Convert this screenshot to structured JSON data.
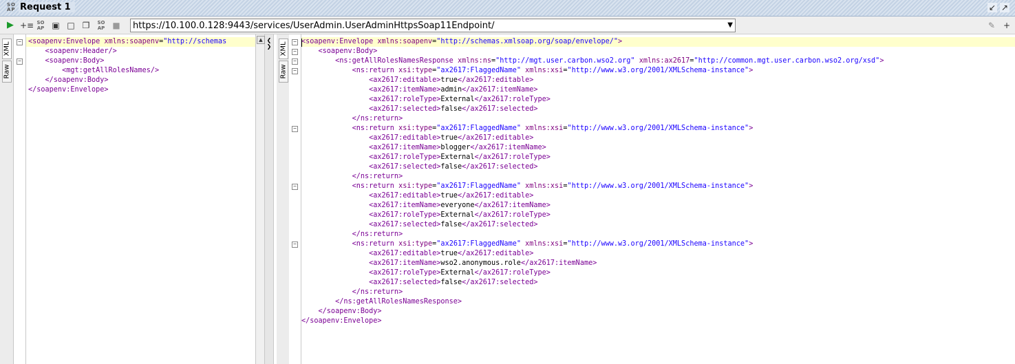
{
  "title_bar": {
    "soap_logo": "SO AP",
    "title": "Request 1",
    "restore_icon": "restore-icon",
    "maximize_icon": "maximize-icon"
  },
  "toolbar": {
    "url": "https://10.100.0.128:9443/services/UserAdmin.UserAdminHttpsSoap11Endpoint/",
    "icons": [
      "run-icon",
      "add-assertion-icon",
      "soap-logo-icon",
      "soap-logo-icon",
      "fit-icon",
      "window-icon",
      "copy-icon",
      "soap-logo-icon",
      "stop-icon",
      "dropdown-icon",
      "settings-icon",
      "add-icon"
    ]
  },
  "request_panel": {
    "tabs": [
      "XML",
      "Raw"
    ],
    "lines": [
      [
        {
          "t": "<soapenv:Envelope ",
          "c": "tag"
        },
        {
          "t": "xmlns:soapenv",
          "c": "attr"
        },
        {
          "t": "=",
          "c": "txt"
        },
        {
          "t": "\"http://schemas",
          "c": "val"
        }
      ],
      [
        {
          "t": "    <soapenv:Header/>",
          "c": "tag"
        }
      ],
      [
        {
          "t": "    <soapenv:Body>",
          "c": "tag"
        }
      ],
      [
        {
          "t": "        <mgt:getAllRolesNames/>",
          "c": "tag"
        }
      ],
      [
        {
          "t": "    </soapenv:Body>",
          "c": "tag"
        }
      ],
      [
        {
          "t": "</soapenv:Envelope>",
          "c": "tag"
        }
      ]
    ]
  },
  "response_panel": {
    "tabs": [
      "XML",
      "Raw"
    ],
    "lines": [
      [
        {
          "t": "<soapenv:Envelope ",
          "c": "tag"
        },
        {
          "t": "xmlns:soapenv",
          "c": "attr"
        },
        {
          "t": "=",
          "c": "txt"
        },
        {
          "t": "\"http://schemas.xmlsoap.org/soap/envelope/\"",
          "c": "val"
        },
        {
          "t": ">",
          "c": "tag"
        }
      ],
      [
        {
          "t": "    <soapenv:Body>",
          "c": "tag"
        }
      ],
      [
        {
          "t": "        <ns:getAllRolesNamesResponse ",
          "c": "tag"
        },
        {
          "t": "xmlns:ns",
          "c": "attr"
        },
        {
          "t": "=",
          "c": "txt"
        },
        {
          "t": "\"http://mgt.user.carbon.wso2.org\"",
          "c": "val"
        },
        {
          "t": " xmlns:ax2617",
          "c": "attr"
        },
        {
          "t": "=",
          "c": "txt"
        },
        {
          "t": "\"http://common.mgt.user.carbon.wso2.org/xsd\"",
          "c": "val"
        },
        {
          "t": ">",
          "c": "tag"
        }
      ],
      [
        {
          "t": "            <ns:return ",
          "c": "tag"
        },
        {
          "t": "xsi:type",
          "c": "attr"
        },
        {
          "t": "=",
          "c": "txt"
        },
        {
          "t": "\"ax2617:FlaggedName\"",
          "c": "val"
        },
        {
          "t": " xmlns:xsi",
          "c": "attr"
        },
        {
          "t": "=",
          "c": "txt"
        },
        {
          "t": "\"http://www.w3.org/2001/XMLSchema-instance\"",
          "c": "val"
        },
        {
          "t": ">",
          "c": "tag"
        }
      ],
      [
        {
          "t": "                <ax2617:editable>",
          "c": "tag"
        },
        {
          "t": "true",
          "c": "txt"
        },
        {
          "t": "</ax2617:editable>",
          "c": "tag"
        }
      ],
      [
        {
          "t": "                <ax2617:itemName>",
          "c": "tag"
        },
        {
          "t": "admin",
          "c": "txt"
        },
        {
          "t": "</ax2617:itemName>",
          "c": "tag"
        }
      ],
      [
        {
          "t": "                <ax2617:roleType>",
          "c": "tag"
        },
        {
          "t": "External",
          "c": "txt"
        },
        {
          "t": "</ax2617:roleType>",
          "c": "tag"
        }
      ],
      [
        {
          "t": "                <ax2617:selected>",
          "c": "tag"
        },
        {
          "t": "false",
          "c": "txt"
        },
        {
          "t": "</ax2617:selected>",
          "c": "tag"
        }
      ],
      [
        {
          "t": "            </ns:return>",
          "c": "tag"
        }
      ],
      [
        {
          "t": "            <ns:return ",
          "c": "tag"
        },
        {
          "t": "xsi:type",
          "c": "attr"
        },
        {
          "t": "=",
          "c": "txt"
        },
        {
          "t": "\"ax2617:FlaggedName\"",
          "c": "val"
        },
        {
          "t": " xmlns:xsi",
          "c": "attr"
        },
        {
          "t": "=",
          "c": "txt"
        },
        {
          "t": "\"http://www.w3.org/2001/XMLSchema-instance\"",
          "c": "val"
        },
        {
          "t": ">",
          "c": "tag"
        }
      ],
      [
        {
          "t": "                <ax2617:editable>",
          "c": "tag"
        },
        {
          "t": "true",
          "c": "txt"
        },
        {
          "t": "</ax2617:editable>",
          "c": "tag"
        }
      ],
      [
        {
          "t": "                <ax2617:itemName>",
          "c": "tag"
        },
        {
          "t": "blogger",
          "c": "txt"
        },
        {
          "t": "</ax2617:itemName>",
          "c": "tag"
        }
      ],
      [
        {
          "t": "                <ax2617:roleType>",
          "c": "tag"
        },
        {
          "t": "External",
          "c": "txt"
        },
        {
          "t": "</ax2617:roleType>",
          "c": "tag"
        }
      ],
      [
        {
          "t": "                <ax2617:selected>",
          "c": "tag"
        },
        {
          "t": "false",
          "c": "txt"
        },
        {
          "t": "</ax2617:selected>",
          "c": "tag"
        }
      ],
      [
        {
          "t": "            </ns:return>",
          "c": "tag"
        }
      ],
      [
        {
          "t": "            <ns:return ",
          "c": "tag"
        },
        {
          "t": "xsi:type",
          "c": "attr"
        },
        {
          "t": "=",
          "c": "txt"
        },
        {
          "t": "\"ax2617:FlaggedName\"",
          "c": "val"
        },
        {
          "t": " xmlns:xsi",
          "c": "attr"
        },
        {
          "t": "=",
          "c": "txt"
        },
        {
          "t": "\"http://www.w3.org/2001/XMLSchema-instance\"",
          "c": "val"
        },
        {
          "t": ">",
          "c": "tag"
        }
      ],
      [
        {
          "t": "                <ax2617:editable>",
          "c": "tag"
        },
        {
          "t": "true",
          "c": "txt"
        },
        {
          "t": "</ax2617:editable>",
          "c": "tag"
        }
      ],
      [
        {
          "t": "                <ax2617:itemName>",
          "c": "tag"
        },
        {
          "t": "everyone",
          "c": "txt"
        },
        {
          "t": "</ax2617:itemName>",
          "c": "tag"
        }
      ],
      [
        {
          "t": "                <ax2617:roleType>",
          "c": "tag"
        },
        {
          "t": "External",
          "c": "txt"
        },
        {
          "t": "</ax2617:roleType>",
          "c": "tag"
        }
      ],
      [
        {
          "t": "                <ax2617:selected>",
          "c": "tag"
        },
        {
          "t": "false",
          "c": "txt"
        },
        {
          "t": "</ax2617:selected>",
          "c": "tag"
        }
      ],
      [
        {
          "t": "            </ns:return>",
          "c": "tag"
        }
      ],
      [
        {
          "t": "            <ns:return ",
          "c": "tag"
        },
        {
          "t": "xsi:type",
          "c": "attr"
        },
        {
          "t": "=",
          "c": "txt"
        },
        {
          "t": "\"ax2617:FlaggedName\"",
          "c": "val"
        },
        {
          "t": " xmlns:xsi",
          "c": "attr"
        },
        {
          "t": "=",
          "c": "txt"
        },
        {
          "t": "\"http://www.w3.org/2001/XMLSchema-instance\"",
          "c": "val"
        },
        {
          "t": ">",
          "c": "tag"
        }
      ],
      [
        {
          "t": "                <ax2617:editable>",
          "c": "tag"
        },
        {
          "t": "true",
          "c": "txt"
        },
        {
          "t": "</ax2617:editable>",
          "c": "tag"
        }
      ],
      [
        {
          "t": "                <ax2617:itemName>",
          "c": "tag"
        },
        {
          "t": "wso2.anonymous.role",
          "c": "txt"
        },
        {
          "t": "</ax2617:itemName>",
          "c": "tag"
        }
      ],
      [
        {
          "t": "                <ax2617:roleType>",
          "c": "tag"
        },
        {
          "t": "External",
          "c": "txt"
        },
        {
          "t": "</ax2617:roleType>",
          "c": "tag"
        }
      ],
      [
        {
          "t": "                <ax2617:selected>",
          "c": "tag"
        },
        {
          "t": "false",
          "c": "txt"
        },
        {
          "t": "</ax2617:selected>",
          "c": "tag"
        }
      ],
      [
        {
          "t": "            </ns:return>",
          "c": "tag"
        }
      ],
      [
        {
          "t": "        </ns:getAllRolesNamesResponse>",
          "c": "tag"
        }
      ],
      [
        {
          "t": "    </soapenv:Body>",
          "c": "tag"
        }
      ],
      [
        {
          "t": "</soapenv:Envelope>",
          "c": "tag"
        }
      ]
    ]
  },
  "colors": {
    "tag": "#7a0094",
    "attr": "#7f007f",
    "value": "#1a00ff",
    "text": "#000000",
    "current_line": "#ffffcc"
  }
}
